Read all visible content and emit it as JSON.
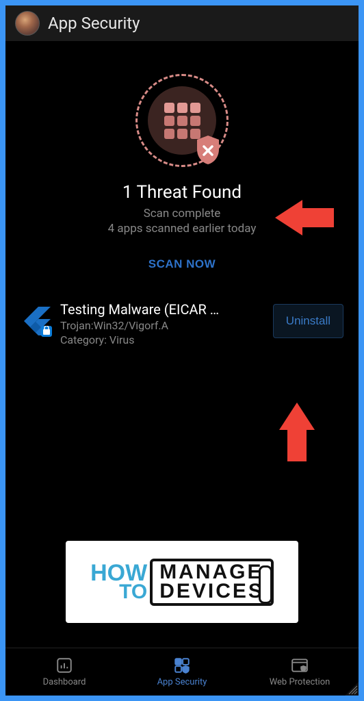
{
  "header": {
    "title": "App Security"
  },
  "threat": {
    "title": "1 Threat Found",
    "status": "Scan complete",
    "substatus": "4 apps scanned earlier today",
    "scan_now_label": "SCAN NOW"
  },
  "threat_item": {
    "name": "Testing Malware (EICAR …",
    "signature": "Trojan:Win32/Vigorf.A",
    "category": "Category: Virus",
    "uninstall_label": "Uninstall"
  },
  "logo": {
    "how": "HOW",
    "to": "TO",
    "manage": "MANAGE",
    "devices": "DEVICES"
  },
  "nav": {
    "dashboard": "Dashboard",
    "app_security": "App Security",
    "web_protection": "Web Protection"
  },
  "colors": {
    "accent": "#3a7bc8",
    "threat": "#d88b87",
    "frame": "#3b95f5"
  }
}
